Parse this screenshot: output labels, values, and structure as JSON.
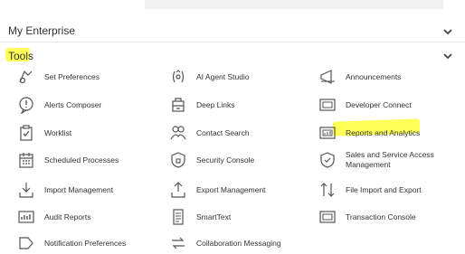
{
  "sections": {
    "my_enterprise": "My Enterprise",
    "tools": "Tools"
  },
  "tools": [
    {
      "label": "Set Preferences",
      "icon": "set-preferences-icon"
    },
    {
      "label": "AI Agent Studio",
      "icon": "ai-agent-studio-icon"
    },
    {
      "label": "Announcements",
      "icon": "announcements-icon"
    },
    {
      "label": "Alerts Composer",
      "icon": "alerts-composer-icon"
    },
    {
      "label": "Deep Links",
      "icon": "deep-links-icon"
    },
    {
      "label": "Developer Connect",
      "icon": "developer-connect-icon"
    },
    {
      "label": "Worklist",
      "icon": "worklist-icon"
    },
    {
      "label": "Contact Search",
      "icon": "contact-search-icon"
    },
    {
      "label": "Reports and Analytics",
      "icon": "reports-analytics-icon"
    },
    {
      "label": "Scheduled Processes",
      "icon": "scheduled-processes-icon"
    },
    {
      "label": "Security Console",
      "icon": "security-console-icon"
    },
    {
      "label": "Sales and Service Access Management",
      "icon": "sales-service-access-icon"
    },
    {
      "label": "Import Management",
      "icon": "import-management-icon"
    },
    {
      "label": "Export Management",
      "icon": "export-management-icon"
    },
    {
      "label": "File Import and Export",
      "icon": "file-import-export-icon"
    },
    {
      "label": "Audit Reports",
      "icon": "audit-reports-icon"
    },
    {
      "label": "SmartText",
      "icon": "smarttext-icon"
    },
    {
      "label": "Transaction Console",
      "icon": "transaction-console-icon"
    },
    {
      "label": "Notification Preferences",
      "icon": "notification-preferences-icon"
    },
    {
      "label": "Collaboration Messaging",
      "icon": "collaboration-messaging-icon"
    }
  ],
  "colors": {
    "highlight": "#ffff3b",
    "icon_stroke": "#555555",
    "text": "#333333"
  }
}
